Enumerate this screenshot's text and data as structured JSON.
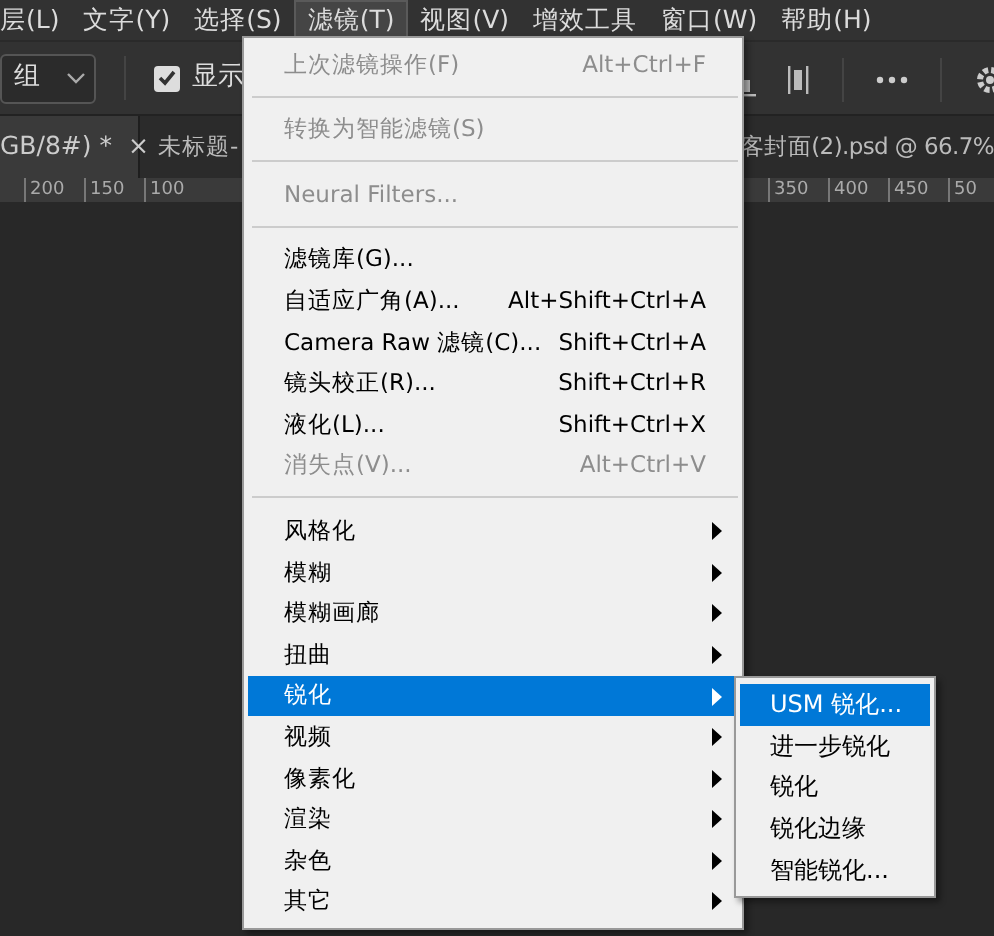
{
  "menubar": [
    {
      "label": "层(L)",
      "selected": false
    },
    {
      "label": "文字(Y)",
      "selected": false
    },
    {
      "label": "选择(S)",
      "selected": false
    },
    {
      "label": "滤镜(T)",
      "selected": true
    },
    {
      "label": "视图(V)",
      "selected": false
    },
    {
      "label": "增效工具",
      "selected": false
    },
    {
      "label": "窗口(W)",
      "selected": false
    },
    {
      "label": "帮助(H)",
      "selected": false
    }
  ],
  "options_bar": {
    "dropdown": {
      "value": "组"
    },
    "checkbox": {
      "label": "显示",
      "checked": true
    }
  },
  "doc_tabs": [
    {
      "label": "GB/8#) *",
      "close": "×"
    },
    {
      "label": "未标题-"
    },
    {
      "label": "客封面(2).psd @ 66.7%"
    }
  ],
  "ruler": {
    "left_labels": [
      "200",
      "150",
      "100"
    ],
    "right_labels": [
      "350",
      "400",
      "450",
      "50"
    ]
  },
  "filter_menu": [
    {
      "kind": "item",
      "label": "上次滤镜操作(F)",
      "shortcut": "Alt+Ctrl+F",
      "disabled": true,
      "submenu": false,
      "selected": false
    },
    {
      "kind": "separator"
    },
    {
      "kind": "item",
      "label": "转换为智能滤镜(S)",
      "disabled": true,
      "submenu": false,
      "selected": false
    },
    {
      "kind": "separator"
    },
    {
      "kind": "item",
      "label": "Neural Filters...",
      "disabled": true,
      "submenu": false,
      "selected": false
    },
    {
      "kind": "separator"
    },
    {
      "kind": "item",
      "label": "滤镜库(G)...",
      "disabled": false,
      "submenu": false,
      "selected": false
    },
    {
      "kind": "item",
      "label": "自适应广角(A)...",
      "shortcut": "Alt+Shift+Ctrl+A",
      "disabled": false,
      "submenu": false,
      "selected": false
    },
    {
      "kind": "item",
      "label": "Camera Raw 滤镜(C)...",
      "shortcut": "Shift+Ctrl+A",
      "disabled": false,
      "submenu": false,
      "selected": false
    },
    {
      "kind": "item",
      "label": "镜头校正(R)...",
      "shortcut": "Shift+Ctrl+R",
      "disabled": false,
      "submenu": false,
      "selected": false
    },
    {
      "kind": "item",
      "label": "液化(L)...",
      "shortcut": "Shift+Ctrl+X",
      "disabled": false,
      "submenu": false,
      "selected": false
    },
    {
      "kind": "item",
      "label": "消失点(V)...",
      "shortcut": "Alt+Ctrl+V",
      "disabled": true,
      "submenu": false,
      "selected": false
    },
    {
      "kind": "separator"
    },
    {
      "kind": "item",
      "label": "风格化",
      "disabled": false,
      "submenu": true,
      "selected": false
    },
    {
      "kind": "item",
      "label": "模糊",
      "disabled": false,
      "submenu": true,
      "selected": false
    },
    {
      "kind": "item",
      "label": "模糊画廊",
      "disabled": false,
      "submenu": true,
      "selected": false
    },
    {
      "kind": "item",
      "label": "扭曲",
      "disabled": false,
      "submenu": true,
      "selected": false
    },
    {
      "kind": "item",
      "label": "锐化",
      "disabled": false,
      "submenu": true,
      "selected": true
    },
    {
      "kind": "item",
      "label": "视频",
      "disabled": false,
      "submenu": true,
      "selected": false
    },
    {
      "kind": "item",
      "label": "像素化",
      "disabled": false,
      "submenu": true,
      "selected": false
    },
    {
      "kind": "item",
      "label": "渲染",
      "disabled": false,
      "submenu": true,
      "selected": false
    },
    {
      "kind": "item",
      "label": "杂色",
      "disabled": false,
      "submenu": true,
      "selected": false
    },
    {
      "kind": "item",
      "label": "其它",
      "disabled": false,
      "submenu": true,
      "selected": false
    }
  ],
  "sharpen_submenu": [
    {
      "label": "USM 锐化...",
      "selected": true
    },
    {
      "label": "进一步锐化",
      "selected": false
    },
    {
      "label": "锐化",
      "selected": false
    },
    {
      "label": "锐化边缘",
      "selected": false
    },
    {
      "label": "智能锐化...",
      "selected": false
    }
  ]
}
